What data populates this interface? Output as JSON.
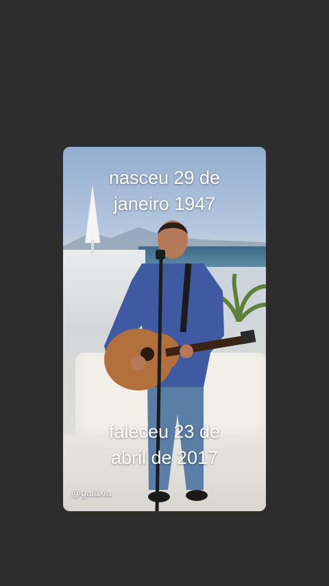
{
  "story": {
    "caption_top_line1": "nasceu 29 de",
    "caption_top_line2": "janeiro 1947",
    "caption_bottom_line1": "faleceu 23 de",
    "caption_bottom_line2": "abril de 2017",
    "watermark": "@galáxia"
  },
  "colors": {
    "background": "#2e2d2d",
    "caption_text": "#ffffff"
  }
}
